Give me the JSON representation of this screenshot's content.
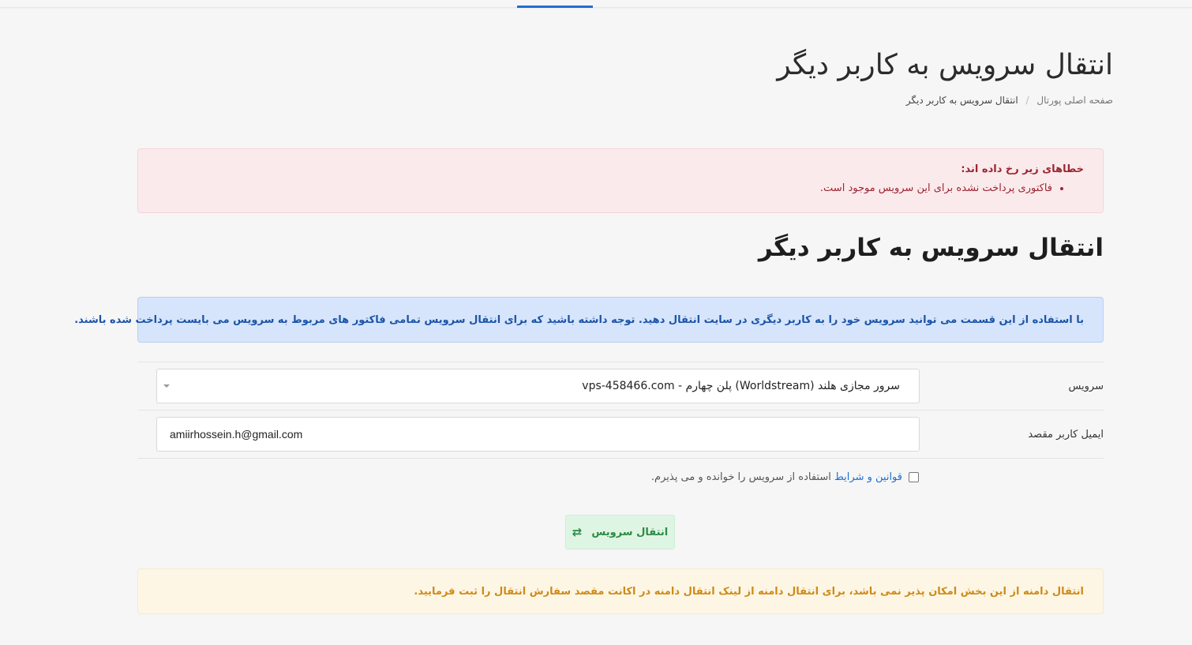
{
  "header": {
    "title": "انتقال سرویس به کاربر دیگر",
    "breadcrumb": {
      "home": "صفحه اصلی پورتال",
      "separator": "/",
      "current": "انتقال سرویس به کاربر دیگر"
    }
  },
  "error_alert": {
    "title": "خطاهای زیر رخ داده اند:",
    "items": [
      "فاکتوری پرداخت نشده برای این سرویس موجود است."
    ]
  },
  "section": {
    "title": "انتقال سرویس به کاربر دیگر"
  },
  "info_alert": {
    "text": "با استفاده از این قسمت می توانید سرویس خود را به کاربر دیگری در سایت انتقال دهید. توجه داشته باشید که برای انتقال سرویس تمامی فاکتور های مربوط به سرویس می بایست پرداخت شده باشند."
  },
  "form": {
    "service_label": "سرویس",
    "service_value": "سرور مجازی هلند (Worldstream) پلن چهارم - vps-458466.com",
    "email_label": "ایمیل کاربر مقصد",
    "email_value": "amiirhossein.h@gmail.com",
    "terms_link": "قوانین و شرایط",
    "terms_text": "استفاده از سرویس را خوانده و می پذیرم.",
    "terms_checked": false,
    "submit_label": "انتقال سرویس",
    "submit_icon": "swap-arrows-icon"
  },
  "warning_alert": {
    "text": "انتقال دامنه از این بخش امکان پذیر نمی باشد، برای انتقال دامنه از لینک انتقال دامنه در اکانت مقصد سفارش انتقال را ثبت فرمایید."
  },
  "colors": {
    "accent": "#1f6fd1",
    "error_bg": "#fbeaec",
    "error_text": "#9a2530",
    "info_bg": "#d6e5fb",
    "info_text": "#1c54a8",
    "warning_bg": "#fdf6e5",
    "warning_text": "#d08a16",
    "success_bg": "#dff5e4",
    "success_text": "#2d8a45"
  }
}
